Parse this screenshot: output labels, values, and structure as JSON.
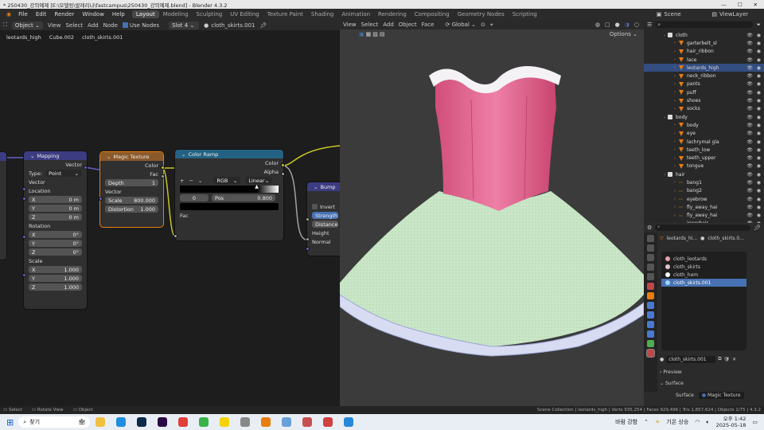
{
  "titlebar": {
    "title": "* 250430_강의예제 [E:\\모델링\\발레리나\\fastcampus\\250430_강의예제.blend] - Blender 4.3.2",
    "min": "—",
    "max": "☐",
    "close": "✕"
  },
  "menu": [
    "File",
    "Edit",
    "Render",
    "Window",
    "Help"
  ],
  "workspaces": [
    "Layout",
    "Modeling",
    "Sculpting",
    "UV Editing",
    "Texture Paint",
    "Shading",
    "Animation",
    "Rendering",
    "Compositing",
    "Geometry Nodes",
    "Scripting"
  ],
  "scene": {
    "label": "Scene",
    "viewlayer": "ViewLayer"
  },
  "node_header": {
    "mode": "Object",
    "view": "View",
    "select": "Select",
    "add": "Add",
    "node": "Node",
    "use_nodes": "Use Nodes",
    "slot": "Slot 4",
    "material": "cloth_skirts.001"
  },
  "breadcrumb": {
    "object": "leotards_high",
    "mesh": "Cube.002",
    "material": "cloth_skirts.001"
  },
  "mapping": {
    "title": "Mapping",
    "out": "Vector",
    "type_label": "Type:",
    "type_value": "Point",
    "vector": "Vector",
    "location": "Location",
    "rotation": "Rotation",
    "scale": "Scale",
    "loc": [
      {
        "axis": "X",
        "value": "0 m"
      },
      {
        "axis": "Y",
        "value": "0 m"
      },
      {
        "axis": "Z",
        "value": "0 m"
      }
    ],
    "rot": [
      {
        "axis": "X",
        "value": "0°"
      },
      {
        "axis": "Y",
        "value": "0°"
      },
      {
        "axis": "Z",
        "value": "0°"
      }
    ],
    "scl": [
      {
        "axis": "X",
        "value": "1.000"
      },
      {
        "axis": "Y",
        "value": "1.000"
      },
      {
        "axis": "Z",
        "value": "1.000"
      }
    ]
  },
  "magic": {
    "title": "Magic Texture",
    "color": "Color",
    "fac": "Fac",
    "depth_label": "Depth",
    "depth": "1",
    "vector": "Vector",
    "scale_label": "Scale",
    "scale": "800.000",
    "distortion_label": "Distortion",
    "distortion": "1.000"
  },
  "ramp": {
    "title": "Color Ramp",
    "color": "Color",
    "alpha": "Alpha",
    "plus": "+",
    "minus": "−",
    "mode": "RGB",
    "interp": "Linear",
    "index": "0",
    "pos_label": "Pos",
    "pos": "0.800",
    "fac": "Fac"
  },
  "bump": {
    "title": "Bump",
    "invert": "Invert",
    "strength": "Strength",
    "distance": "Distance",
    "height": "Height",
    "normal": "Normal"
  },
  "viewport_header": {
    "view": "View",
    "select": "Select",
    "add": "Add",
    "object": "Object",
    "face": "Face",
    "orientation": "Global",
    "options": "Options"
  },
  "outliner": {
    "search_placeholder": "",
    "rows": [
      {
        "indent": 0,
        "label": "cloth",
        "type": "coll",
        "sel": false
      },
      {
        "indent": 1,
        "label": "garterbelt_sl",
        "type": "mesh",
        "sel": false
      },
      {
        "indent": 1,
        "label": "hair_ribbon",
        "type": "mesh",
        "sel": false
      },
      {
        "indent": 1,
        "label": "lace",
        "type": "mesh",
        "sel": false
      },
      {
        "indent": 1,
        "label": "leotards_high",
        "type": "mesh",
        "sel": true
      },
      {
        "indent": 1,
        "label": "neck_ribbon",
        "type": "mesh",
        "sel": false
      },
      {
        "indent": 1,
        "label": "pants",
        "type": "mesh",
        "sel": false
      },
      {
        "indent": 1,
        "label": "puff",
        "type": "mesh",
        "sel": false
      },
      {
        "indent": 1,
        "label": "shoes",
        "type": "mesh",
        "sel": false
      },
      {
        "indent": 1,
        "label": "socks",
        "type": "mesh",
        "sel": false
      },
      {
        "indent": 0,
        "label": "body",
        "type": "coll",
        "sel": false
      },
      {
        "indent": 1,
        "label": "body",
        "type": "mesh",
        "sel": false
      },
      {
        "indent": 1,
        "label": "eye",
        "type": "mesh",
        "sel": false
      },
      {
        "indent": 1,
        "label": "lachrymal gla",
        "type": "mesh",
        "sel": false
      },
      {
        "indent": 1,
        "label": "teeth_low",
        "type": "mesh",
        "sel": false
      },
      {
        "indent": 1,
        "label": "teeth_upper",
        "type": "mesh",
        "sel": false
      },
      {
        "indent": 1,
        "label": "tongue",
        "type": "mesh",
        "sel": false
      },
      {
        "indent": 0,
        "label": "hair",
        "type": "coll",
        "sel": false
      },
      {
        "indent": 1,
        "label": "bang1",
        "type": "curve",
        "sel": false
      },
      {
        "indent": 1,
        "label": "bang2",
        "type": "curve",
        "sel": false
      },
      {
        "indent": 1,
        "label": "eyebrow",
        "type": "curve",
        "sel": false
      },
      {
        "indent": 1,
        "label": "fly_away_hai",
        "type": "curve",
        "sel": false
      },
      {
        "indent": 1,
        "label": "fly_away_hai",
        "type": "curve",
        "sel": false
      },
      {
        "indent": 1,
        "label": "innerhair",
        "type": "curve",
        "sel": false
      }
    ]
  },
  "properties": {
    "breadcrumb_obj": "leotards_hi...",
    "breadcrumb_mat": "cloth_skirts.0...",
    "slots": [
      {
        "label": "cloth_leotards",
        "color": "#e8a0b0",
        "sel": false
      },
      {
        "label": "cloth_skirts",
        "color": "#e8c0d0",
        "sel": false
      },
      {
        "label": "cloth_hem",
        "color": "#ffffff",
        "sel": false
      },
      {
        "label": "cloth_skirts.001",
        "color": "#9fd3f0",
        "sel": true
      }
    ],
    "material_name": "cloth_skirts.001",
    "preview": "Preview",
    "surface_panel": "Surface",
    "surface_label": "Surface",
    "surface_value": "Magic Texture"
  },
  "statusbar": {
    "select": "Select",
    "rotate": "Rotate View",
    "object": "Object",
    "stats": "Scene Collection | leotards_high | Verts 935,254 | Faces 929,496 | Tris 1,857,624 | Objects 1/75 | 4.3.2"
  },
  "taskbar": {
    "search": "찾기",
    "weather": "바람 강함",
    "temp": "기온 상승",
    "time": "오후 1:42",
    "date": "2025-05-18"
  },
  "colors": {
    "accent": "#4772b3",
    "mapping_header": "#3c3c83",
    "texture_header": "#8b5a2b",
    "converter_header": "#246283"
  }
}
